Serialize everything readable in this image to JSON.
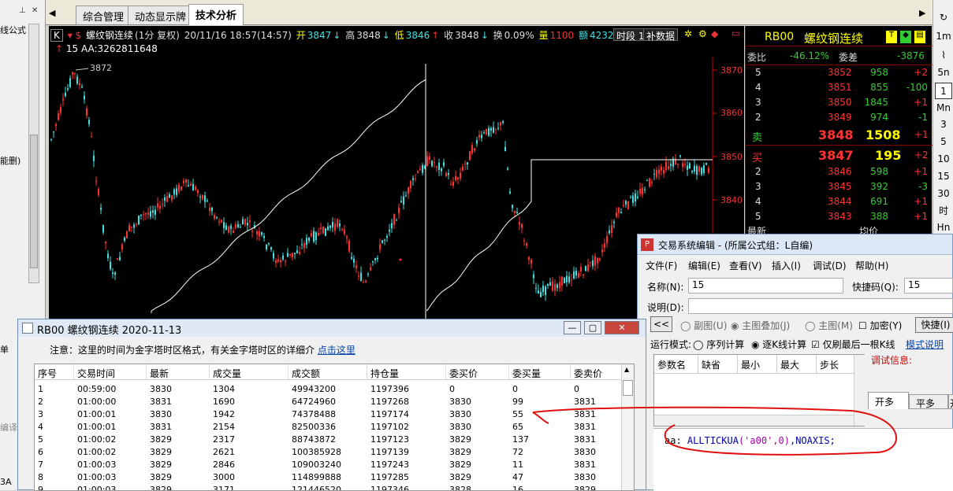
{
  "left_panel": {
    "labels": [
      "线公式",
      "能删)",
      "单",
      "编译"
    ],
    "bottom": "3A"
  },
  "tabs": [
    {
      "label": "综合管理"
    },
    {
      "label": "动态显示牌"
    },
    {
      "label": "技术分析"
    }
  ],
  "chart": {
    "k_label": "K",
    "symbol": "螺纹钢连续",
    "period": "(1分 复权)",
    "datetime": "20/11/16 18:57(14:57)",
    "open_label": "开",
    "open": "3847",
    "high_label": "高",
    "high": "3848",
    "low_label": "低",
    "low": "3846",
    "close_label": "收",
    "close": "3848",
    "turnover_label": "换",
    "turnover": "0.09%",
    "volume_label": "量",
    "volume": "1100",
    "amount_label": "额",
    "amount": "4232",
    "btn_period": "时段 1",
    "btn_supplement": "补数据",
    "indicator_line": "15  AA:3262811648",
    "peak_label": "3872",
    "y_ticks": [
      "3870",
      "3860",
      "3850",
      "3840"
    ],
    "colors": {
      "up": "#ff3030",
      "down": "#40e0e0",
      "line": "#ffffff",
      "axis": "#cc0000"
    }
  },
  "quote": {
    "code": "RB00",
    "name": "螺纹钢连续",
    "wb_label": "委比",
    "wb": "-46.12%",
    "wc_label": "委差",
    "wc": "-3876",
    "asks": [
      {
        "lvl": "5",
        "price": "3852",
        "vol": "958",
        "chg": "+2"
      },
      {
        "lvl": "4",
        "price": "3851",
        "vol": "855",
        "chg": "-100"
      },
      {
        "lvl": "3",
        "price": "3850",
        "vol": "1845",
        "chg": "+1"
      },
      {
        "lvl": "2",
        "price": "3849",
        "vol": "974",
        "chg": "-1"
      }
    ],
    "sell1": {
      "lvl": "卖",
      "price": "3848",
      "vol": "1508",
      "chg": "+1"
    },
    "buy1": {
      "lvl": "买",
      "price": "3847",
      "vol": "195",
      "chg": "+2"
    },
    "bids": [
      {
        "lvl": "2",
        "price": "3846",
        "vol": "598",
        "chg": "+1"
      },
      {
        "lvl": "3",
        "price": "3845",
        "vol": "392",
        "chg": "-3"
      },
      {
        "lvl": "4",
        "price": "3844",
        "vol": "691",
        "chg": "+1"
      },
      {
        "lvl": "5",
        "price": "3843",
        "vol": "388",
        "chg": "+1"
      }
    ],
    "last_label": "最新",
    "avg_label": "均价"
  },
  "right_toolbar": [
    "1m",
    "5n",
    "1",
    "Mn",
    "3",
    "5",
    "10",
    "15",
    "30",
    "时",
    "Hn"
  ],
  "editor": {
    "title": "交易系统编辑 - (所属公式组：L自编)",
    "menus": [
      "文件(F)",
      "编辑(E)",
      "查看(V)",
      "插入(I)",
      "调试(D)",
      "帮助(H)"
    ],
    "name_label": "名称(N):",
    "name_value": "15",
    "shortcut_label": "快捷码(Q):",
    "shortcut_value": "15",
    "desc_label": "说明(D):",
    "radios": [
      "副图(U)",
      "主图叠加(J)",
      "主图(M)"
    ],
    "encrypt_label": "加密(Y)",
    "quick_btn": "快捷(I)",
    "mode_label": "运行模式:",
    "mode_opts": [
      "序列计算",
      "逐K线计算"
    ],
    "last_k_label": "仅刷最后一根K线",
    "mode_help": "模式说明",
    "debug_label": "调试信息:",
    "param_headers": [
      "参数名",
      "缺省",
      "最小",
      "最大",
      "步长"
    ],
    "side_tabs": [
      "开多",
      "平多",
      "开"
    ],
    "code_prefix": "aa:",
    "code_fn": "ALLTICKUA",
    "code_arg": "('a00',0)",
    "code_suffix": ",NOAXIS;"
  },
  "tick_window": {
    "title": "RB00 螺纹钢连续 2020-11-13",
    "note": "注意：这里的时间为金字塔时区格式，有关金字塔时区的详细介",
    "note_link": "点击这里",
    "headers": [
      "序号",
      "交易时间",
      "最新",
      "成交量",
      "成交额",
      "持仓量",
      "委买价",
      "委买量",
      "委卖价"
    ],
    "rows": [
      [
        "1",
        "00:59:00",
        "3830",
        "1304",
        "49943200",
        "1197396",
        "0",
        "0",
        "0"
      ],
      [
        "2",
        "01:00:00",
        "3831",
        "1690",
        "64724960",
        "1197268",
        "3830",
        "99",
        "3831"
      ],
      [
        "3",
        "01:00:01",
        "3830",
        "1942",
        "74378488",
        "1197174",
        "3830",
        "55",
        "3831"
      ],
      [
        "4",
        "01:00:01",
        "3831",
        "2154",
        "82500336",
        "1197102",
        "3830",
        "65",
        "3831"
      ],
      [
        "5",
        "01:00:02",
        "3829",
        "2317",
        "88743872",
        "1197123",
        "3829",
        "137",
        "3831"
      ],
      [
        "6",
        "01:00:02",
        "3829",
        "2621",
        "100385928",
        "1197139",
        "3829",
        "72",
        "3830"
      ],
      [
        "7",
        "01:00:03",
        "3829",
        "2846",
        "109003240",
        "1197243",
        "3829",
        "11",
        "3831"
      ],
      [
        "8",
        "01:00:03",
        "3829",
        "3000",
        "114899888",
        "1197285",
        "3829",
        "47",
        "3830"
      ],
      [
        "9",
        "01:00:03",
        "3829",
        "3171",
        "121446520",
        "1197346",
        "3828",
        "16",
        "3829"
      ]
    ]
  },
  "annotation_color": "#e01010"
}
